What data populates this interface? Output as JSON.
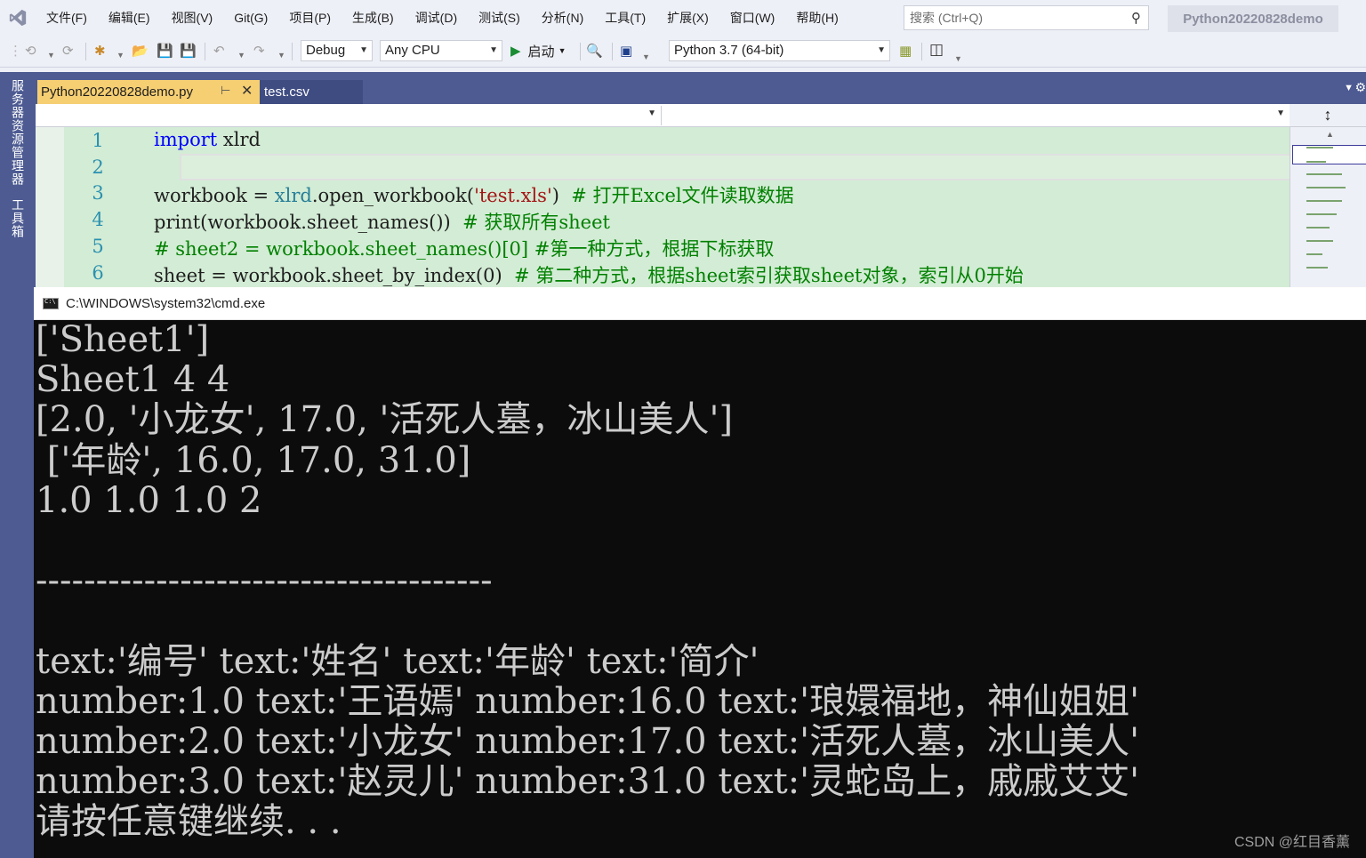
{
  "menubar": {
    "items": [
      "文件(F)",
      "编辑(E)",
      "视图(V)",
      "Git(G)",
      "项目(P)",
      "生成(B)",
      "调试(D)",
      "测试(S)",
      "分析(N)",
      "工具(T)",
      "扩展(X)",
      "窗口(W)",
      "帮助(H)"
    ],
    "search_placeholder": "搜索 (Ctrl+Q)",
    "solution_name": "Python20220828demo"
  },
  "toolbar": {
    "configuration": "Debug",
    "platform": "Any CPU",
    "start_label": "启动",
    "environment": "Python 3.7 (64-bit)"
  },
  "side_panel": {
    "tabs": [
      "服务器资源管理器",
      "工具箱"
    ]
  },
  "tabs": {
    "active": "Python20220828demo.py",
    "inactive": "test.csv"
  },
  "editor": {
    "lines": [
      {
        "num": "1",
        "parts": [
          {
            "t": "kw",
            "v": "import"
          },
          {
            "t": "txt",
            "v": " xlrd"
          }
        ]
      },
      {
        "num": "2",
        "parts": []
      },
      {
        "num": "3",
        "parts": [
          {
            "t": "txt",
            "v": "workbook = "
          },
          {
            "t": "mod",
            "v": "xlrd"
          },
          {
            "t": "txt",
            "v": ".open_workbook("
          },
          {
            "t": "str",
            "v": "'test.xls'"
          },
          {
            "t": "txt",
            "v": ")  "
          },
          {
            "t": "cmt",
            "v": "# 打开Excel文件读取数据"
          }
        ]
      },
      {
        "num": "4",
        "parts": [
          {
            "t": "txt",
            "v": "print(workbook.sheet_names())  "
          },
          {
            "t": "cmt",
            "v": "# 获取所有sheet"
          }
        ]
      },
      {
        "num": "5",
        "parts": [
          {
            "t": "cmt",
            "v": "# sheet2 = workbook.sheet_names()[0] #第一种方式，根据下标获取"
          }
        ]
      },
      {
        "num": "6",
        "parts": [
          {
            "t": "txt",
            "v": "sheet = workbook.sheet_by_index(0)  "
          },
          {
            "t": "cmt",
            "v": "# 第二种方式，根据sheet索引获取sheet对象，索引从0开始"
          }
        ]
      }
    ]
  },
  "console": {
    "title": "C:\\WINDOWS\\system32\\cmd.exe",
    "lines": [
      "['Sheet1']",
      "Sheet1 4 4",
      "[2.0, '小龙女', 17.0, '活死人墓，冰山美人']",
      " ['年龄', 16.0, 17.0, 31.0]",
      "1.0 1.0 1.0 2",
      "",
      "--------------------------------------",
      "",
      "text:'编号' text:'姓名' text:'年龄' text:'简介'",
      "number:1.0 text:'王语嫣' number:16.0 text:'琅嬛福地，神仙姐姐'",
      "number:2.0 text:'小龙女' number:17.0 text:'活死人墓，冰山美人'",
      "number:3.0 text:'赵灵儿' number:31.0 text:'灵蛇岛上，戚戚艾艾'",
      "请按任意键继续. . ."
    ]
  },
  "watermark": "CSDN @红目香薰",
  "colors": {
    "accent_tab": "#f6cf73",
    "side_panel": "#4d5b92",
    "editor_bg": "#d3ecd5",
    "console_bg": "#0c0c0c",
    "console_text": "#cccccc",
    "keyword": "#0000ff",
    "string": "#a31515",
    "comment": "#008000"
  }
}
